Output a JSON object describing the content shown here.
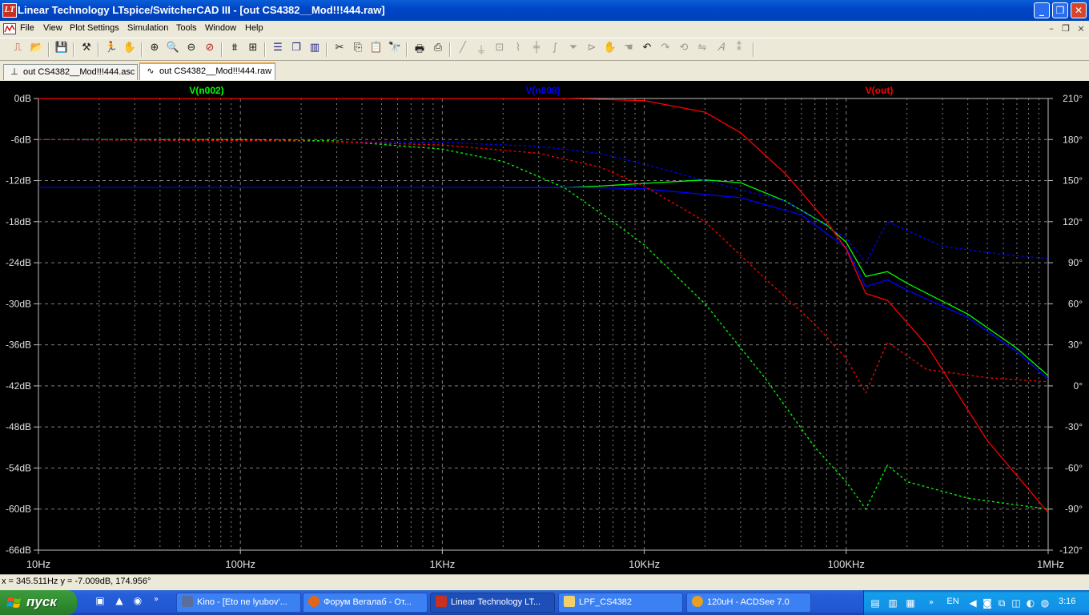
{
  "window": {
    "title": "Linear Technology LTspice/SwitcherCAD III - [out CS4382__Mod!!!444.raw]",
    "controls": {
      "minimize": "_",
      "restore": "❐",
      "close": "✕"
    }
  },
  "menu": {
    "items": [
      {
        "label": "File",
        "icon": "file-menu"
      },
      {
        "label": "View"
      },
      {
        "label": "Plot Settings"
      },
      {
        "label": "Simulation"
      },
      {
        "label": "Tools"
      },
      {
        "label": "Window"
      },
      {
        "label": "Help"
      }
    ],
    "mdi_controls": {
      "minimize": "–",
      "restore": "❐",
      "close": "×"
    }
  },
  "toolbar": {
    "icons": [
      "new-schematic-icon",
      "open-icon",
      "save-icon",
      "control-panel-icon",
      "run-icon",
      "halt-icon",
      "zoom-in-icon",
      "zoom-out-icon",
      "zoom-back-icon",
      "zoom-cancel-icon",
      "autorange-icon",
      "zoom-full-icon",
      "tile-horizontal-icon",
      "cascade-icon",
      "tile-vertical-icon",
      "cut-icon",
      "copy-icon",
      "paste-icon",
      "find-icon",
      "print-setup-icon",
      "print-icon",
      "wire-icon",
      "ground-icon",
      "label-icon",
      "resistor-icon",
      "capacitor-icon",
      "inductor-icon",
      "diode-icon",
      "component-icon",
      "move-icon",
      "drag-icon",
      "undo-icon",
      "redo-icon",
      "rotate-icon",
      "mirror-icon",
      "text-icon",
      "spice-directive-icon"
    ]
  },
  "tabs": [
    {
      "label": "out CS4382__Mod!!!444.asc",
      "icon": "schematic-icon",
      "active": false
    },
    {
      "label": "out CS4382__Mod!!!444.raw",
      "icon": "waveform-icon",
      "active": true
    }
  ],
  "plot": {
    "traces": [
      {
        "label": "V(n002)",
        "color": "#00ff00"
      },
      {
        "label": "V(n008)",
        "color": "#0000ff"
      },
      {
        "label": "V(out)",
        "color": "#ff0000"
      }
    ],
    "y_left_ticks": [
      "0dB",
      "-6dB",
      "-12dB",
      "-18dB",
      "-24dB",
      "-30dB",
      "-36dB",
      "-42dB",
      "-48dB",
      "-54dB",
      "-60dB",
      "-66dB"
    ],
    "y_right_ticks": [
      "210°",
      "180°",
      "150°",
      "120°",
      "90°",
      "60°",
      "30°",
      "0°",
      "-30°",
      "-60°",
      "-90°",
      "-120°"
    ],
    "x_ticks": [
      "10Hz",
      "100Hz",
      "1KHz",
      "10KHz",
      "100KHz",
      "1MHz"
    ],
    "background": "#000000",
    "grid_color": "#808080"
  },
  "chart_data": {
    "type": "line",
    "title": "",
    "xlabel": "",
    "ylabel": "",
    "x_scale": "log",
    "xlim": [
      10,
      1000000
    ],
    "ylim": [
      -66,
      0
    ],
    "y2lim": [
      -120,
      210
    ],
    "grid": true,
    "legend": "top",
    "series": [
      {
        "name": "V(n002)",
        "kind": "magnitude",
        "unit": "dB",
        "color": "#00ff00",
        "points": [
          [
            2000,
            -13.0
          ],
          [
            4000,
            -13.0
          ],
          [
            6000,
            -12.8
          ],
          [
            10000,
            -12.4
          ],
          [
            20000,
            -11.9
          ],
          [
            30000,
            -12.3
          ],
          [
            50000,
            -15.0
          ],
          [
            80000,
            -18.5
          ],
          [
            100000,
            -21.0
          ],
          [
            125000,
            -26.0
          ],
          [
            160000,
            -25.3
          ],
          [
            200000,
            -27.0
          ],
          [
            400000,
            -31.5
          ],
          [
            700000,
            -36.5
          ],
          [
            1000000,
            -40.5
          ]
        ]
      },
      {
        "name": "V(n002)",
        "kind": "phase",
        "unit": "deg",
        "color": "#00ff00",
        "points": [
          [
            10,
            180
          ],
          [
            100,
            180
          ],
          [
            300,
            179
          ],
          [
            1000,
            173
          ],
          [
            2000,
            164
          ],
          [
            4000,
            145
          ],
          [
            7000,
            120
          ],
          [
            10000,
            103
          ],
          [
            20000,
            60
          ],
          [
            40000,
            5
          ],
          [
            70000,
            -45
          ],
          [
            100000,
            -70
          ],
          [
            125000,
            -90
          ],
          [
            160000,
            -58
          ],
          [
            200000,
            -70
          ],
          [
            400000,
            -82
          ],
          [
            700000,
            -87
          ],
          [
            1000000,
            -90
          ]
        ]
      },
      {
        "name": "V(n008)",
        "kind": "magnitude",
        "unit": "dB",
        "color": "#0000ff",
        "points": [
          [
            10,
            -13.0
          ],
          [
            1000,
            -13.0
          ],
          [
            5000,
            -13.0
          ],
          [
            10000,
            -13.2
          ],
          [
            30000,
            -14.5
          ],
          [
            60000,
            -17.0
          ],
          [
            100000,
            -21.8
          ],
          [
            125000,
            -27.5
          ],
          [
            160000,
            -26.5
          ],
          [
            200000,
            -28.0
          ],
          [
            400000,
            -32.0
          ],
          [
            700000,
            -37.0
          ],
          [
            1000000,
            -41.0
          ]
        ]
      },
      {
        "name": "V(n008)",
        "kind": "phase",
        "unit": "deg",
        "color": "#0000ff",
        "points": [
          [
            10,
            180
          ],
          [
            1000,
            178
          ],
          [
            3000,
            175
          ],
          [
            6000,
            170
          ],
          [
            10000,
            162
          ],
          [
            20000,
            150
          ],
          [
            50000,
            135
          ],
          [
            100000,
            108
          ],
          [
            125000,
            90
          ],
          [
            160000,
            120
          ],
          [
            300000,
            102
          ],
          [
            600000,
            96
          ],
          [
            1000000,
            93
          ]
        ]
      },
      {
        "name": "V(out)",
        "kind": "magnitude",
        "unit": "dB",
        "color": "#ff0000",
        "points": [
          [
            10,
            0
          ],
          [
            4000,
            0
          ],
          [
            10000,
            -0.3
          ],
          [
            20000,
            -2.0
          ],
          [
            30000,
            -5.0
          ],
          [
            50000,
            -11.0
          ],
          [
            80000,
            -18.0
          ],
          [
            100000,
            -22.0
          ],
          [
            125000,
            -28.5
          ],
          [
            160000,
            -29.5
          ],
          [
            250000,
            -36.0
          ],
          [
            500000,
            -50.0
          ],
          [
            1000000,
            -60.5
          ]
        ]
      },
      {
        "name": "V(out)",
        "kind": "phase",
        "unit": "deg",
        "color": "#ff0000",
        "points": [
          [
            10,
            180
          ],
          [
            200,
            179
          ],
          [
            1000,
            176
          ],
          [
            3000,
            170
          ],
          [
            6000,
            160
          ],
          [
            10000,
            146
          ],
          [
            20000,
            120
          ],
          [
            40000,
            78
          ],
          [
            70000,
            45
          ],
          [
            100000,
            20
          ],
          [
            125000,
            -5
          ],
          [
            160000,
            32
          ],
          [
            250000,
            12
          ],
          [
            500000,
            6
          ],
          [
            1000000,
            3
          ]
        ]
      }
    ]
  },
  "status": {
    "readout": "x = 345.511Hz   y = -7.009dB, 174.956°"
  },
  "taskbar": {
    "start_label": "пуск",
    "quick_launch": [
      "acrobat-icon",
      "pdf-icon",
      "explorer-icon"
    ],
    "tasks": [
      {
        "label": "Kino - [Eto ne lyubov'...",
        "icon": "media-icon",
        "active": false
      },
      {
        "label": "Форум Вегалаб - От...",
        "icon": "firefox-icon",
        "active": false
      },
      {
        "label": "Linear Technology LT...",
        "icon": "ltspice-icon",
        "active": true
      },
      {
        "label": "LPF_CS4382",
        "icon": "folder-icon",
        "active": false
      },
      {
        "label": "120uH - ACDSee 7.0",
        "icon": "acdsee-icon",
        "active": false
      }
    ],
    "lang": "EN",
    "clock": "3:16"
  }
}
